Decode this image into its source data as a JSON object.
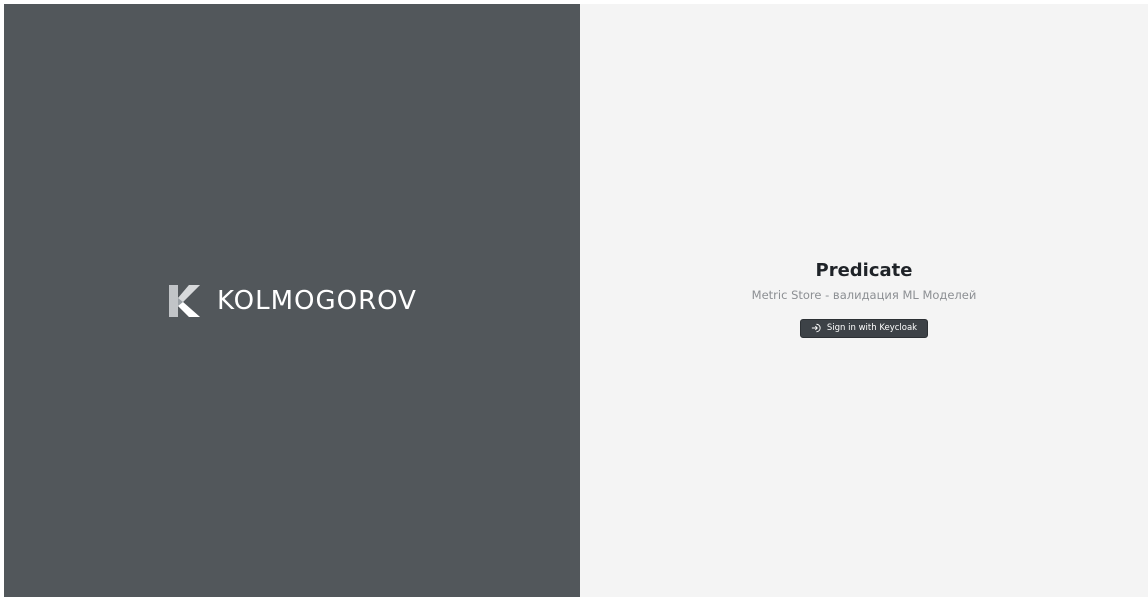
{
  "brand": {
    "logo_icon": "kolmogorov-logo-icon",
    "name": "KOLMOGOROV",
    "panel_color": "#52575b"
  },
  "auth": {
    "title": "Predicate",
    "subtitle": "Metric Store - валидация ML Моделей",
    "button_label": "Sign in with Keycloak",
    "button_icon": "login-icon",
    "button_color": "#3d4247",
    "background_color": "#f4f4f4"
  }
}
